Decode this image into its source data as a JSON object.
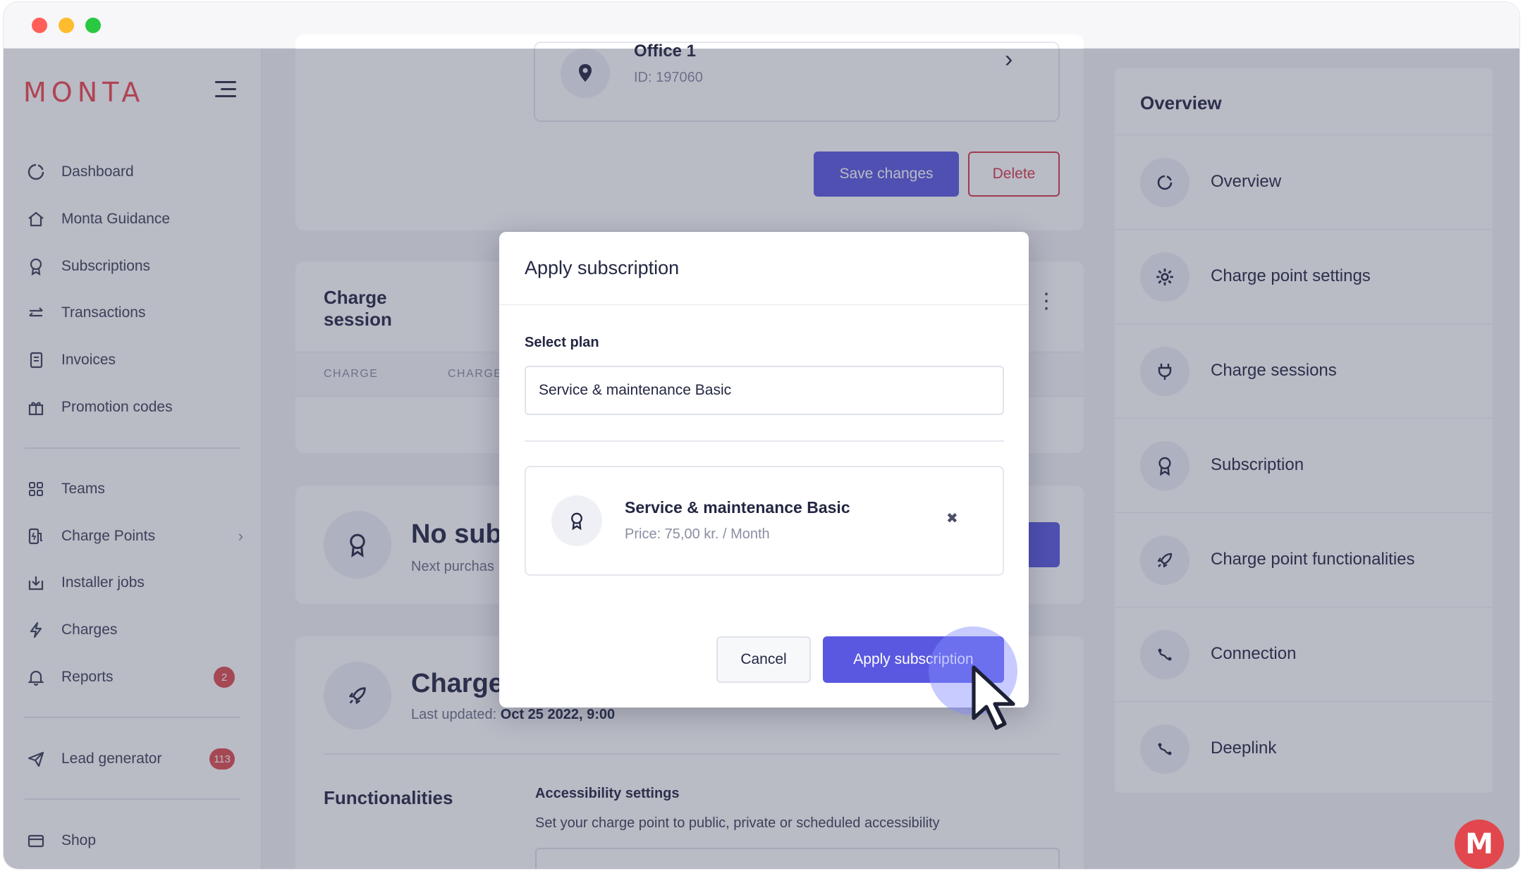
{
  "brand": {
    "logo_text": "MONTA"
  },
  "sidebar": {
    "items": [
      {
        "label": "Dashboard",
        "icon": "dashboard-icon"
      },
      {
        "label": "Monta Guidance",
        "icon": "home-icon"
      },
      {
        "label": "Subscriptions",
        "icon": "award-icon"
      },
      {
        "label": "Transactions",
        "icon": "arrows-icon"
      },
      {
        "label": "Invoices",
        "icon": "invoice-icon"
      },
      {
        "label": "Promotion codes",
        "icon": "gift-icon"
      },
      {
        "label": "Teams",
        "icon": "grid-icon"
      },
      {
        "label": "Charge Points",
        "icon": "charge-point-icon"
      },
      {
        "label": "Installer jobs",
        "icon": "download-icon"
      },
      {
        "label": "Charges",
        "icon": "bolt-icon"
      },
      {
        "label": "Reports",
        "icon": "bell-icon",
        "badge": "2"
      },
      {
        "label": "Lead generator",
        "icon": "send-icon",
        "badge": "113"
      },
      {
        "label": "Shop",
        "icon": "card-icon"
      }
    ]
  },
  "location": {
    "name": "Office 1",
    "id_text": "ID: 197060"
  },
  "actions": {
    "save": "Save changes",
    "delete": "Delete"
  },
  "charge_session": {
    "title_line1": "Charge",
    "title_line2": "session",
    "col1": "CHARGE",
    "col2": "CHARGE"
  },
  "subscription_card": {
    "title": "No subs",
    "subtitle": "Next purchas"
  },
  "functionalities_card": {
    "title": "Charge",
    "updated_label": "Last updated:",
    "updated_value": "Oct 25 2022, 9:00",
    "section_title": "Functionalities",
    "access_title": "Accessibility settings",
    "access_desc": "Set your charge point to public, private or scheduled accessibility"
  },
  "overview": {
    "title": "Overview",
    "items": [
      {
        "label": "Overview",
        "icon": "refresh-icon"
      },
      {
        "label": "Charge point settings",
        "icon": "gear-icon"
      },
      {
        "label": "Charge sessions",
        "icon": "plug-icon"
      },
      {
        "label": "Subscription",
        "icon": "award-icon"
      },
      {
        "label": "Charge point functionalities",
        "icon": "rocket-icon"
      },
      {
        "label": "Connection",
        "icon": "connection-icon"
      },
      {
        "label": "Deeplink",
        "icon": "link-icon"
      }
    ]
  },
  "modal": {
    "title": "Apply subscription",
    "select_label": "Select plan",
    "select_value": "Service & maintenance Basic",
    "plan_name": "Service & maintenance Basic",
    "plan_price": "Price: 75,00 kr. / Month",
    "cancel": "Cancel",
    "apply": "Apply subscription"
  },
  "fab": {
    "label": "M"
  }
}
